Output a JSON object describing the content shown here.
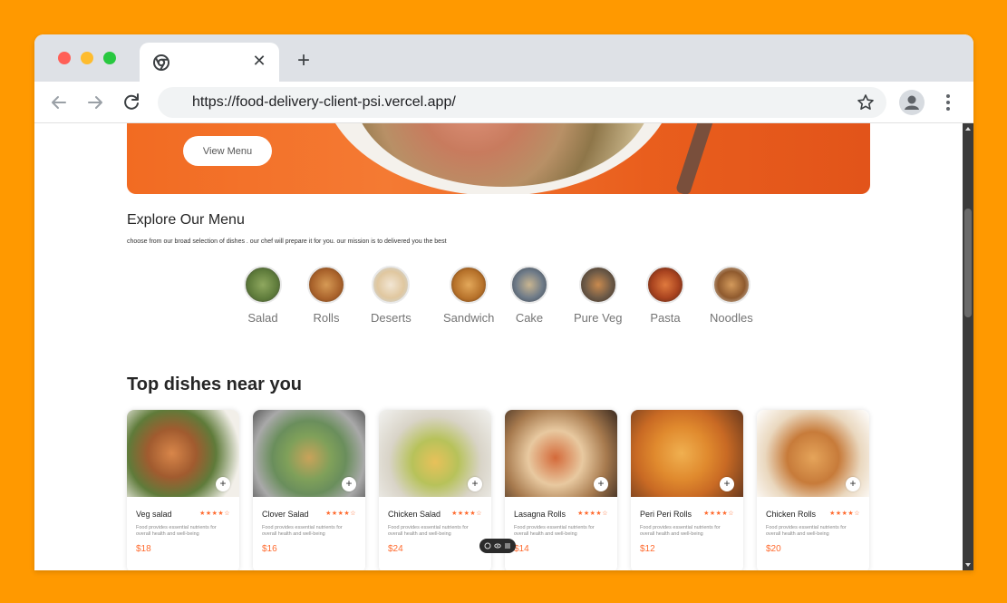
{
  "browser": {
    "tab_close": "✕",
    "new_tab": "+",
    "url": "https://food-delivery-client-psi.vercel.app/"
  },
  "hero": {
    "button_label": "View Menu"
  },
  "explore": {
    "title": "Explore Our Menu",
    "description": "choose from our broad selection of dishes . our chef will prepare it for you. our mission is to delivered you the best",
    "categories": [
      {
        "label": "Salad",
        "color": "#6f8a4a"
      },
      {
        "label": "Rolls",
        "color": "#b0702f"
      },
      {
        "label": "Deserts",
        "color": "#e6d7c3"
      },
      {
        "label": "Sandwich",
        "color": "#b7782e"
      },
      {
        "label": "Cake",
        "color": "#7a8390"
      },
      {
        "label": "Pure Veg",
        "color": "#6d5a47"
      },
      {
        "label": "Pasta",
        "color": "#a9431f"
      },
      {
        "label": "Noodles",
        "color": "#8f5a2e"
      }
    ]
  },
  "top_dishes": {
    "title": "Top dishes near you",
    "add_label": "+",
    "stars": "★★★★☆",
    "items": [
      {
        "name": "Veg salad",
        "description": "Food provides essential nutrients for overall health and well-being",
        "price": "$18"
      },
      {
        "name": "Clover Salad",
        "description": "Food provides essential nutrients for overall health and well-being",
        "price": "$16"
      },
      {
        "name": "Chicken Salad",
        "description": "Food provides essential nutrients for overall health and well-being",
        "price": "$24"
      },
      {
        "name": "Lasagna Rolls",
        "description": "Food provides essential nutrients for overall health and well-being",
        "price": "$14"
      },
      {
        "name": "Peri Peri Rolls",
        "description": "Food provides essential nutrients for overall health and well-being",
        "price": "$12"
      },
      {
        "name": "Chicken Rolls",
        "description": "Food provides essential nutrients for overall health and well-being",
        "price": "$20"
      }
    ]
  },
  "colors": {
    "background": "#FF9900",
    "accent": "#FF6A2E",
    "hero": "#F26B22"
  }
}
